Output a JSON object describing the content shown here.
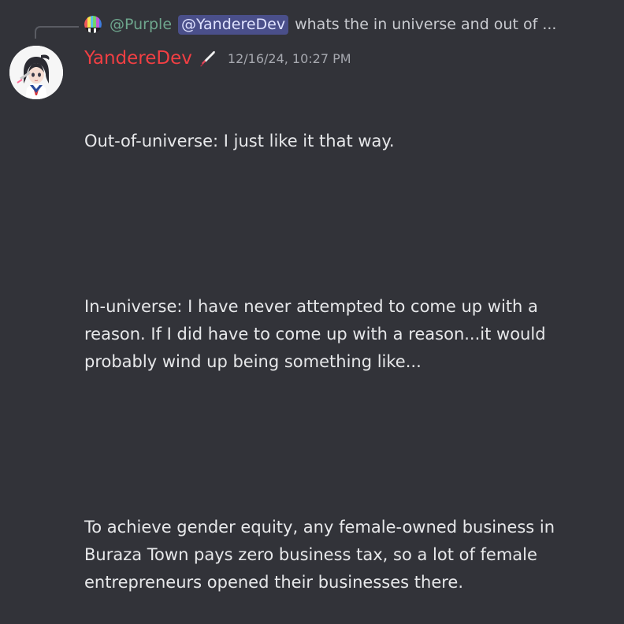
{
  "reply": {
    "author": "@Purple",
    "mention": "@YandereDev",
    "snippet": "whats the in universe and out of ..."
  },
  "message": {
    "author": "YandereDev",
    "role_icon": "katana-icon",
    "timestamp": "12/16/24, 10:27 PM",
    "paragraphs": [
      "Out-of-universe: I just like it that way.",
      "In-universe: I have never attempted to come up with a reason. If I did have to come up with a reason...it would probably wind up being something like...",
      "To achieve gender equity, any female-owned business in Buraza Town pays zero business tax, so a lot of female entrepreneurs opened their businesses there."
    ]
  },
  "colors": {
    "background": "#323339",
    "username": "#f23f43",
    "reply_author": "#6ea68d",
    "mention_bg": "#4a4f8a"
  }
}
